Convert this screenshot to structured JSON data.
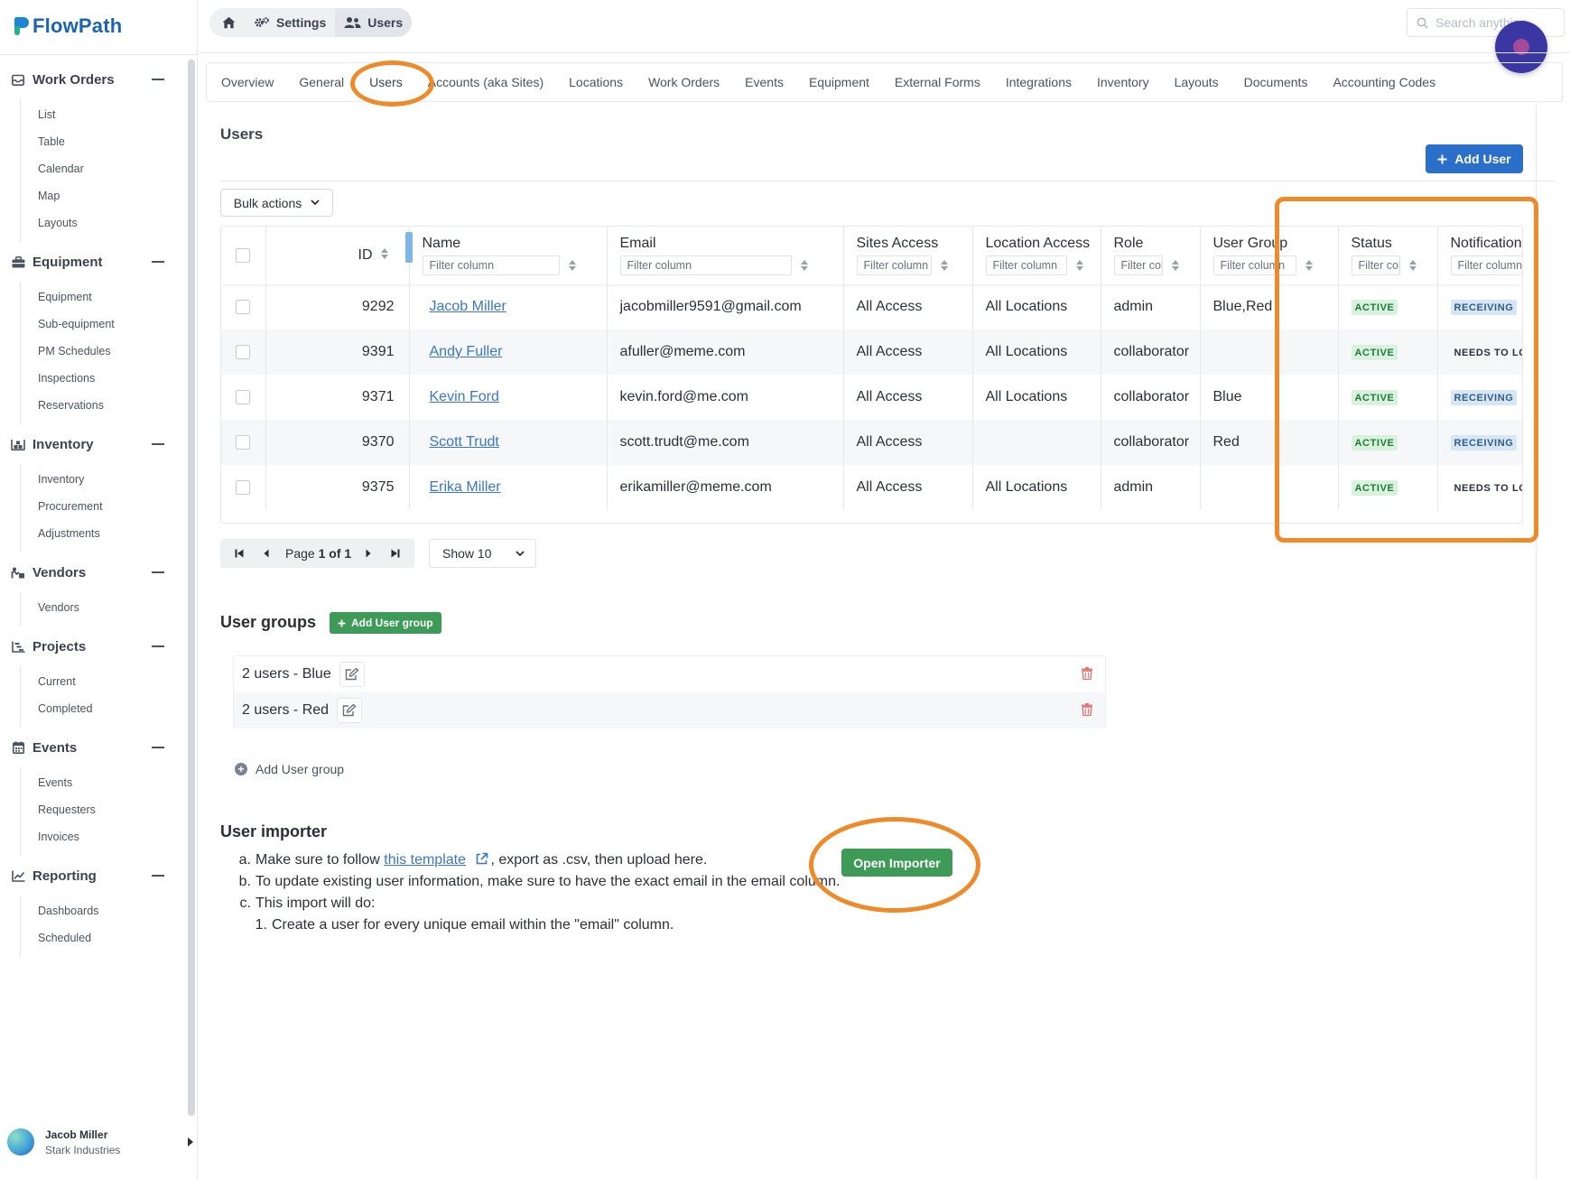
{
  "app": {
    "name": "FlowPath"
  },
  "colors": {
    "primary": "#2a6fc9",
    "success": "#3e9a57",
    "annotation": "#ef8a2b",
    "link": "#3a77c4"
  },
  "sidebar": {
    "sections": [
      {
        "label": "Work Orders",
        "icon": "clipboard-icon",
        "items": [
          "List",
          "Table",
          "Calendar",
          "Map",
          "Layouts"
        ]
      },
      {
        "label": "Equipment",
        "icon": "toolbox-icon",
        "items": [
          "Equipment",
          "Sub-equipment",
          "PM Schedules",
          "Inspections",
          "Reservations"
        ]
      },
      {
        "label": "Inventory",
        "icon": "warehouse-icon",
        "items": [
          "Inventory",
          "Procurement",
          "Adjustments"
        ]
      },
      {
        "label": "Vendors",
        "icon": "vendor-icon",
        "items": [
          "Vendors"
        ]
      },
      {
        "label": "Projects",
        "icon": "gantt-icon",
        "items": [
          "Current",
          "Completed"
        ]
      },
      {
        "label": "Events",
        "icon": "calendar-icon",
        "items": [
          "Events",
          "Requesters",
          "Invoices"
        ]
      },
      {
        "label": "Reporting",
        "icon": "line-chart-icon",
        "items": [
          "Dashboards",
          "Scheduled"
        ]
      }
    ],
    "user": {
      "name": "Jacob Miller",
      "org": "Stark Industries"
    }
  },
  "breadcrumb": {
    "settings": "Settings",
    "users": "Users"
  },
  "search": {
    "placeholder": "Search anything..."
  },
  "tabs": [
    "Overview",
    "General",
    "Users",
    "Accounts (aka Sites)",
    "Locations",
    "Work Orders",
    "Events",
    "Equipment",
    "External Forms",
    "Integrations",
    "Inventory",
    "Layouts",
    "Documents",
    "Accounting Codes"
  ],
  "active_tab": "Users",
  "users": {
    "title": "Users",
    "add_label": "Add User",
    "bulk_label": "Bulk actions",
    "filter_placeholder": "Filter column",
    "columns": [
      "ID",
      "Name",
      "Email",
      "Sites Access",
      "Location Access",
      "Role",
      "User Group",
      "Status",
      "Notifications"
    ],
    "rows": [
      {
        "id": "9292",
        "name": "Jacob Miller",
        "email": "jacobmiller9591@gmail.com",
        "sites": "All Access",
        "locations": "All Locations",
        "role": "admin",
        "group": "Blue,Red",
        "status": "ACTIVE",
        "notifications": "RECEIVING"
      },
      {
        "id": "9391",
        "name": "Andy Fuller",
        "email": "afuller@meme.com",
        "sites": "All Access",
        "locations": "All Locations",
        "role": "collaborator",
        "group": "",
        "status": "ACTIVE",
        "notifications": "NEEDS TO LOGIN"
      },
      {
        "id": "9371",
        "name": "Kevin Ford",
        "email": "kevin.ford@me.com",
        "sites": "All Access",
        "locations": "All Locations",
        "role": "collaborator",
        "group": "Blue",
        "status": "ACTIVE",
        "notifications": "RECEIVING"
      },
      {
        "id": "9370",
        "name": "Scott Trudt",
        "email": "scott.trudt@me.com",
        "sites": "All Access",
        "locations": "",
        "role": "collaborator",
        "group": "Red",
        "status": "ACTIVE",
        "notifications": "RECEIVING"
      },
      {
        "id": "9375",
        "name": "Erika Miller",
        "email": "erikamiller@meme.com",
        "sites": "All Access",
        "locations": "All Locations",
        "role": "admin",
        "group": "",
        "status": "ACTIVE",
        "notifications": "NEEDS TO LOGIN"
      }
    ],
    "pagination": {
      "page_word": "Page",
      "page": "1",
      "of_word": "of",
      "total": "1",
      "show_label": "Show 10"
    }
  },
  "user_groups": {
    "title": "User groups",
    "add_button": "Add User group",
    "groups": [
      "2 users - Blue",
      "2 users - Red"
    ],
    "add_link": "Add User group"
  },
  "importer": {
    "title": "User importer",
    "step_a_marker": "a.",
    "step_a_before": "Make sure to follow ",
    "step_a_link": "this template",
    "step_a_after": ", export as .csv, then upload here.",
    "step_b_marker": "b.",
    "step_b": "To update existing user information, make sure to have the exact email in the email column.",
    "step_c_marker": "c.",
    "step_c": "This import will do:",
    "step_c1_marker": "1.",
    "step_c1": "Create a user for every unique email within the \"email\" column.",
    "button": "Open Importer"
  }
}
